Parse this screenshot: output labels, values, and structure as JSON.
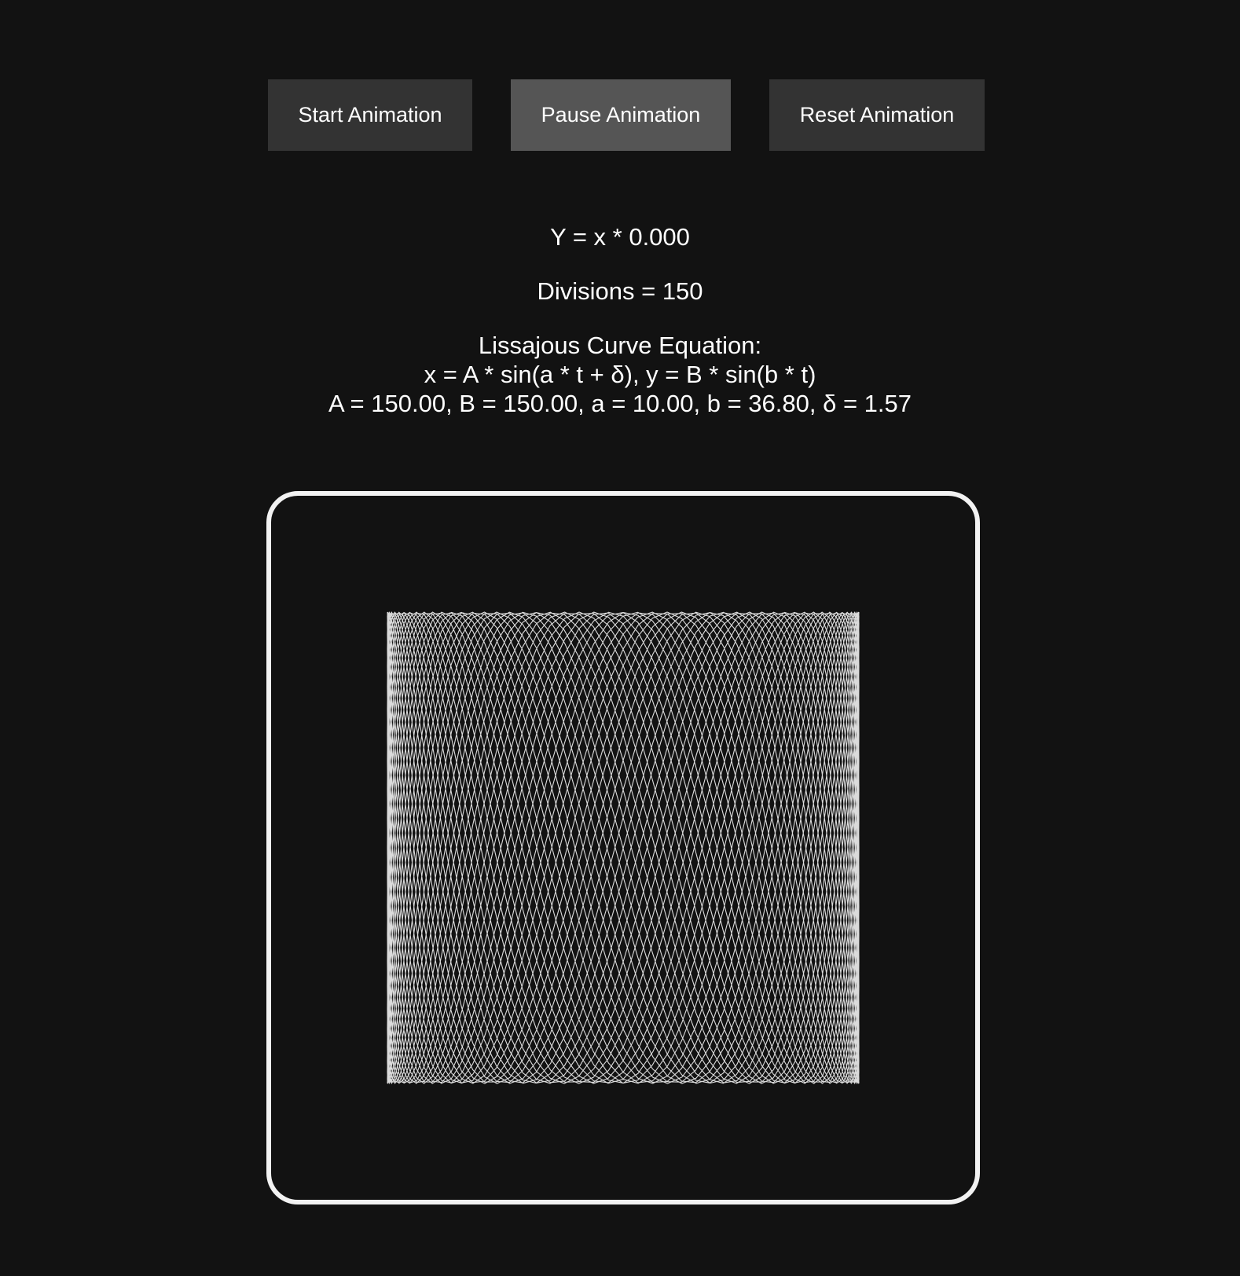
{
  "controls": {
    "start_label": "Start Animation",
    "pause_label": "Pause Animation",
    "reset_label": "Reset Animation"
  },
  "readouts": {
    "y_ratio": "Y = x * 0.000",
    "divisions": "Divisions = 150",
    "equation_title": "Lissajous Curve Equation:",
    "equation_formula": "x = A * sin(a * t + δ), y = B * sin(b * t)",
    "equation_params": "A = 150.00, B = 150.00, a = 10.00, b = 36.80, δ = 1.57"
  },
  "curve": {
    "A": 150,
    "B": 150,
    "a": 10,
    "b": 36.8,
    "delta": 1.57,
    "divisions": 150,
    "color": "#ffffff"
  },
  "theme": {
    "background": "#121212",
    "button": "#333333",
    "button_active": "#555555",
    "frame_border": "#f2f2f2"
  }
}
